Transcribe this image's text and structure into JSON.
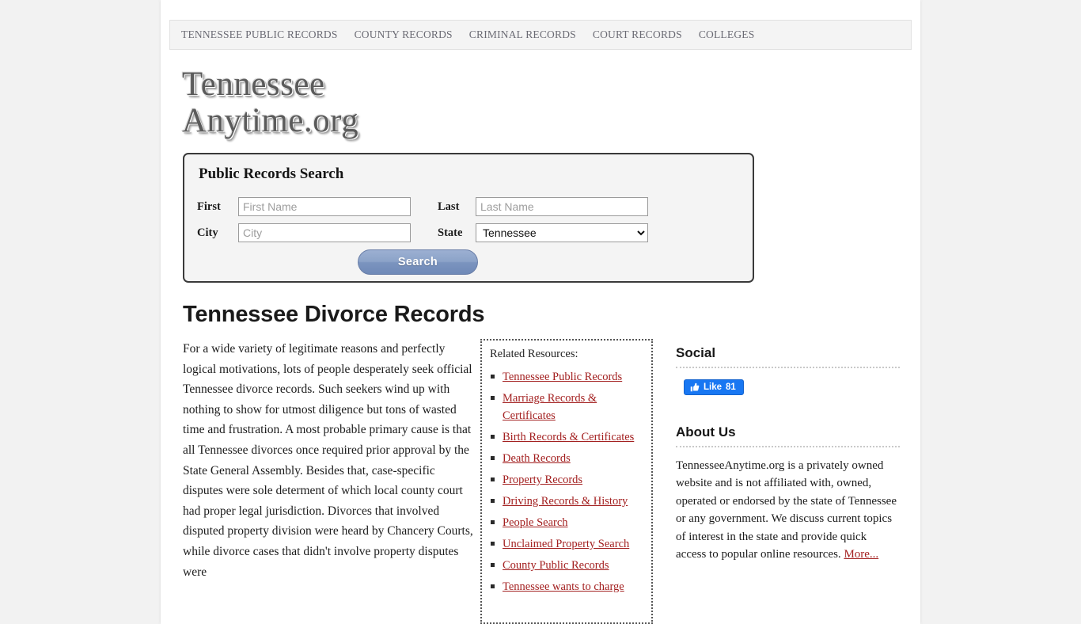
{
  "nav": {
    "items": [
      {
        "label": "TENNESSEE PUBLIC RECORDS"
      },
      {
        "label": "COUNTY RECORDS"
      },
      {
        "label": "CRIMINAL RECORDS"
      },
      {
        "label": "COURT RECORDS"
      },
      {
        "label": "COLLEGES"
      }
    ]
  },
  "logo": {
    "line1": "Tennessee",
    "line2": "Anytime.org"
  },
  "search": {
    "title": "Public Records Search",
    "first_label": "First",
    "first_placeholder": "First Name",
    "last_label": "Last",
    "last_placeholder": "Last Name",
    "city_label": "City",
    "city_placeholder": "City",
    "state_label": "State",
    "state_value": "Tennessee",
    "button_label": "Search"
  },
  "article": {
    "heading": "Tennessee Divorce Records",
    "paragraph": "For a wide variety of legitimate reasons and perfectly logical motivations, lots of people desperately seek official Tennessee divorce records. Such seekers wind up with nothing to show for utmost diligence but tons of wasted time and frustration. A most probable primary cause is that all Tennessee divorces once required prior approval by the State General Assembly. Besides that, case-specific disputes were sole determent of which local county court had proper legal jurisdiction. Divorces that involved disputed property division were heard by Chancery Courts, while divorce cases that didn't involve property disputes were"
  },
  "related": {
    "title": "Related Resources:",
    "links": [
      "Tennessee Public Records",
      "Marriage Records & Certificates",
      "Birth Records & Certificates",
      "Death Records",
      "Property Records",
      "Driving Records & History",
      "People Search",
      "Unclaimed Property Search",
      "County Public Records",
      "Tennessee wants to charge"
    ]
  },
  "sidebar": {
    "social_heading": "Social",
    "like_label": "Like",
    "like_count": "81",
    "about_heading": "About Us",
    "about_text": "TennesseeAnytime.org is a privately owned website and is not affiliated with, owned, operated or endorsed by the state of Tennessee or any government. We discuss current topics of interest in the state and provide quick access to popular online resources. ",
    "about_more": "More..."
  },
  "colors": {
    "link_red": "#a32020",
    "facebook_blue": "#1877f2",
    "button_blue": "#8ba2c8"
  }
}
